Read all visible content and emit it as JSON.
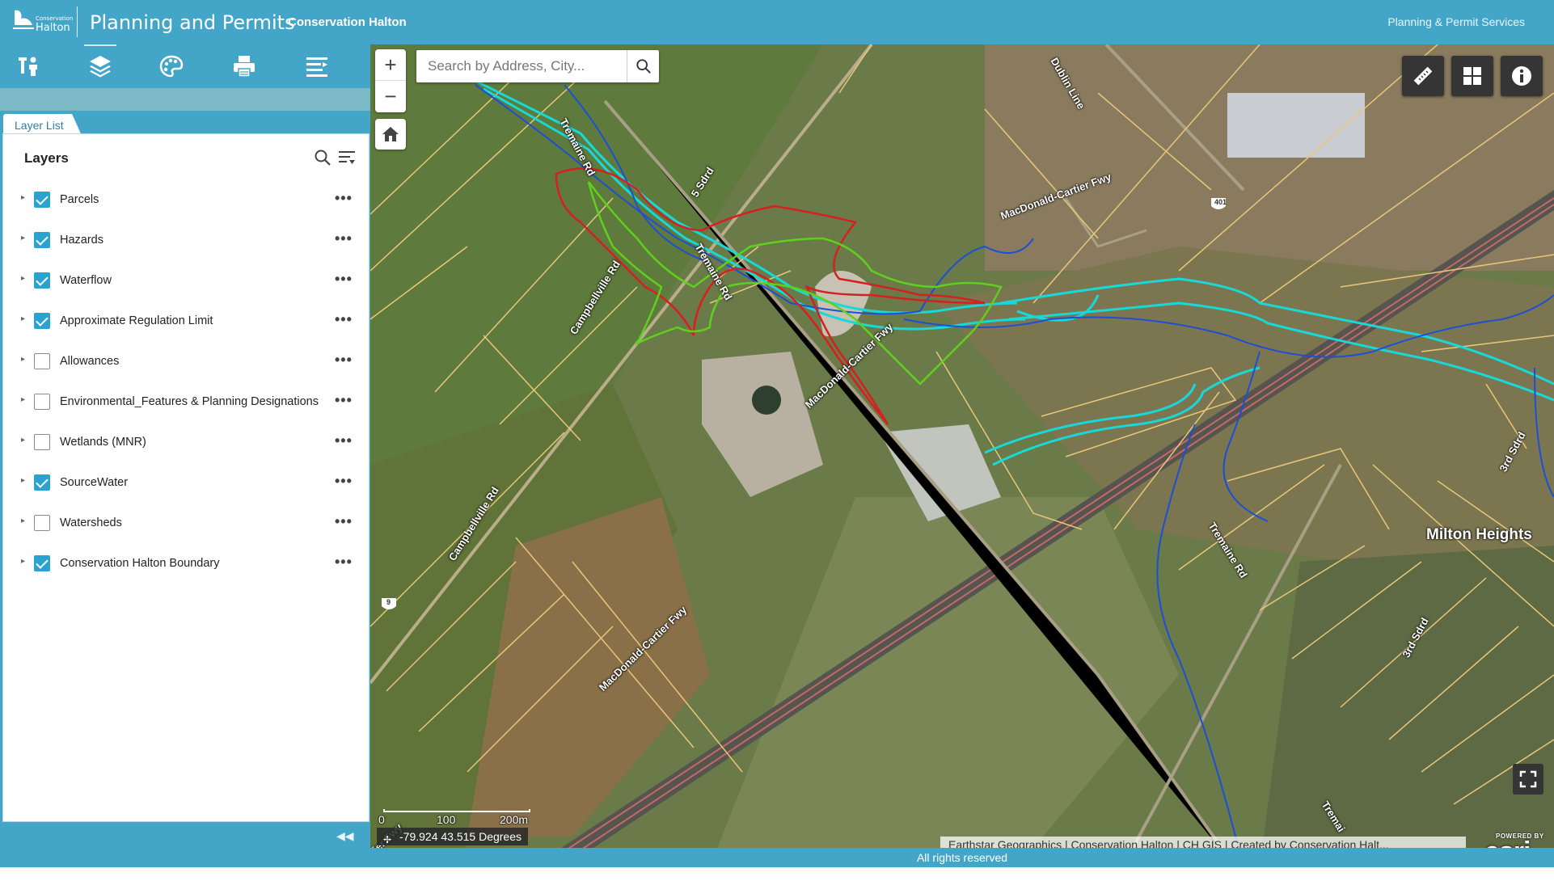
{
  "header": {
    "logo_small": "Conservation",
    "logo_big": "Halton",
    "title": "Planning and Permits",
    "subtitle": "Conservation Halton",
    "link": "Planning & Permit Services"
  },
  "toolbar": {
    "tools": [
      {
        "icon": "identify-person-icon",
        "active": false
      },
      {
        "icon": "layers-icon",
        "active": true
      },
      {
        "icon": "basemap-palette-icon",
        "active": false
      },
      {
        "icon": "print-icon",
        "active": false
      },
      {
        "icon": "legend-list-icon",
        "active": false
      }
    ]
  },
  "panel": {
    "tab_label": "Layer List",
    "heading": "Layers",
    "layers": [
      {
        "name": "Parcels",
        "checked": true
      },
      {
        "name": "Hazards",
        "checked": true
      },
      {
        "name": "Waterflow",
        "checked": true
      },
      {
        "name": "Approximate Regulation Limit",
        "checked": true
      },
      {
        "name": "Allowances",
        "checked": false
      },
      {
        "name": "Environmental_Features & Planning Designations",
        "checked": false
      },
      {
        "name": "Wetlands (MNR)",
        "checked": false
      },
      {
        "name": "SourceWater",
        "checked": true
      },
      {
        "name": "Watersheds",
        "checked": false
      },
      {
        "name": "Conservation Halton Boundary",
        "checked": true
      }
    ],
    "more_glyph": "•••",
    "collapse_glyph": "◀◀"
  },
  "map": {
    "search_placeholder": "Search by Address, City...",
    "zoom_in": "+",
    "zoom_out": "−",
    "labels": {
      "tremaine_top": "Tremaine Rd",
      "tremaine_mid": "Tremaine Rd",
      "tremaine_bottom": "Tremaine Rd",
      "tremaine_far": "Tremai",
      "sdrd5": "5 Sdrd",
      "dublin": "Dublin Line",
      "campbellville_top": "Campbellville Rd",
      "campbellville_bottom": "Campbellville Rd",
      "macdonald_top": "MacDonald-Cartier Fwy",
      "macdonald_mid": "MacDonald-Cartier Fwy",
      "macdonald_bottom": "MacDonald-Cartier Fwy",
      "macdonald_corner": "ier Fwy",
      "sdrd3_top": "3rd Sdrd",
      "sdrd3_bottom": "3rd Sdrd",
      "place": "Milton Heights",
      "shield_401": "401",
      "shield_9": "9"
    },
    "scale": {
      "s0": "0",
      "s100": "100",
      "s200": "200m"
    },
    "coordinates": "-79.924 43.515 Degrees",
    "attribution": "Earthstar Geographics | Conservation Halton | CH GIS | Created by Conservation Halt...",
    "esri_powered": "POWERED BY",
    "esri_word": "esri",
    "colors": {
      "parcel": "#e8c77a",
      "hazard": "#d62020",
      "regulation": "#5fd11c",
      "waterflow": "#1c4fd6",
      "sourcewater": "#18d8d8"
    }
  },
  "footer": {
    "text": "All rights reserved"
  }
}
